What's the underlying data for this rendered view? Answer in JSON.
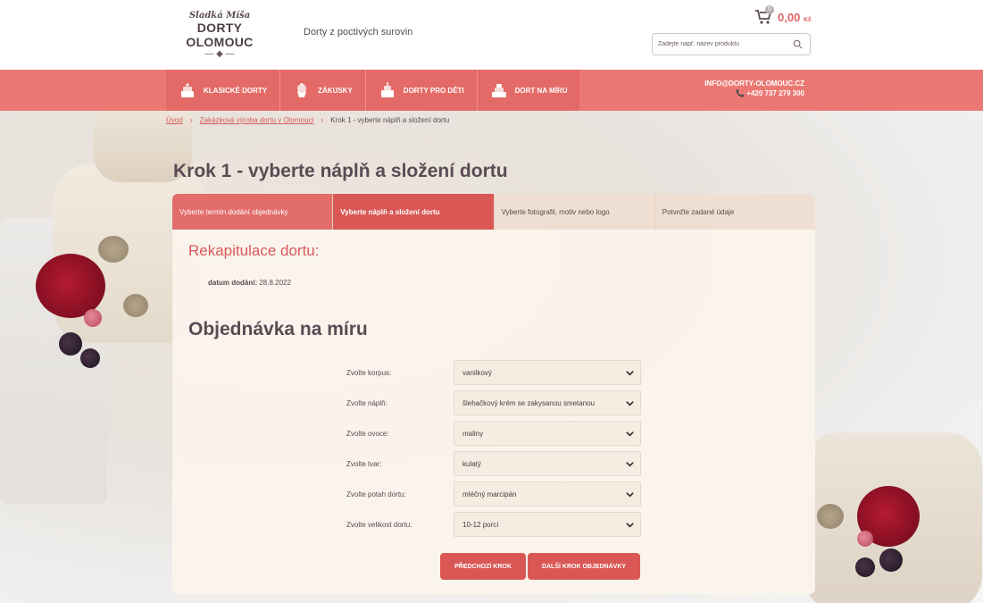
{
  "header": {
    "logo_top": "Sladká Míša",
    "logo_main": "DORTY OLOMOUC",
    "tagline": "Dorty z poctivých surovin",
    "cart_count": "0",
    "cart_price": "0,00",
    "cart_currency": "Kč",
    "search_placeholder": "Zadejte např. název produktu"
  },
  "nav": {
    "items": [
      {
        "label": "Klasické dorty",
        "icon": "cake-icon"
      },
      {
        "label": "Zákusky",
        "icon": "cupcake-icon"
      },
      {
        "label": "Dorty pro děti",
        "icon": "kids-cake-icon"
      },
      {
        "label": "Dort na míru",
        "icon": "custom-cake-icon"
      }
    ],
    "email": "INFO@DORTY-OLOMOUC.CZ",
    "phone": "+420 737 279 300"
  },
  "breadcrumb": {
    "home": "Úvod",
    "section": "Zakázková výroba dortu v Olomouci",
    "current": "Krok 1 - vyberte náplň a složení dortu"
  },
  "page_title": "Krok 1 - vyberte náplň a složení dortu",
  "steps": [
    {
      "label": "Vyberte termín dodání objednávky",
      "state": "done"
    },
    {
      "label": "Vyberte náplň a složení dortu",
      "state": "active"
    },
    {
      "label": "Vyberte fotografii, motiv nebo logo",
      "state": "pending"
    },
    {
      "label": "Potvrďte zadané údaje",
      "state": "pending"
    }
  ],
  "recap": {
    "title": "Rekapitulace dortu:",
    "date_label": "datum dodání:",
    "date_value": "28.8.2022"
  },
  "order_title": "Objednávka na míru",
  "form": [
    {
      "label": "Zvolte korpus:",
      "value": "vanilkový"
    },
    {
      "label": "Zvolte náplň:",
      "value": "šlehačkový krém se zakysanou smetanou"
    },
    {
      "label": "Zvolte ovoce:",
      "value": "maliny"
    },
    {
      "label": "Zvolte tvar:",
      "value": "kulatý"
    },
    {
      "label": "Zvolte potah dortu:",
      "value": "mléčný marcipán"
    },
    {
      "label": "Zvolte velikost dortu:",
      "value": "10-12 porcí"
    }
  ],
  "buttons": {
    "prev": "Předchozí krok",
    "next": "Další krok objednávky"
  },
  "colors": {
    "accent": "#d95856",
    "nav_bg": "#ec7873",
    "step_pending": "#efdfd2",
    "panel_bg": "#faf4ec"
  }
}
